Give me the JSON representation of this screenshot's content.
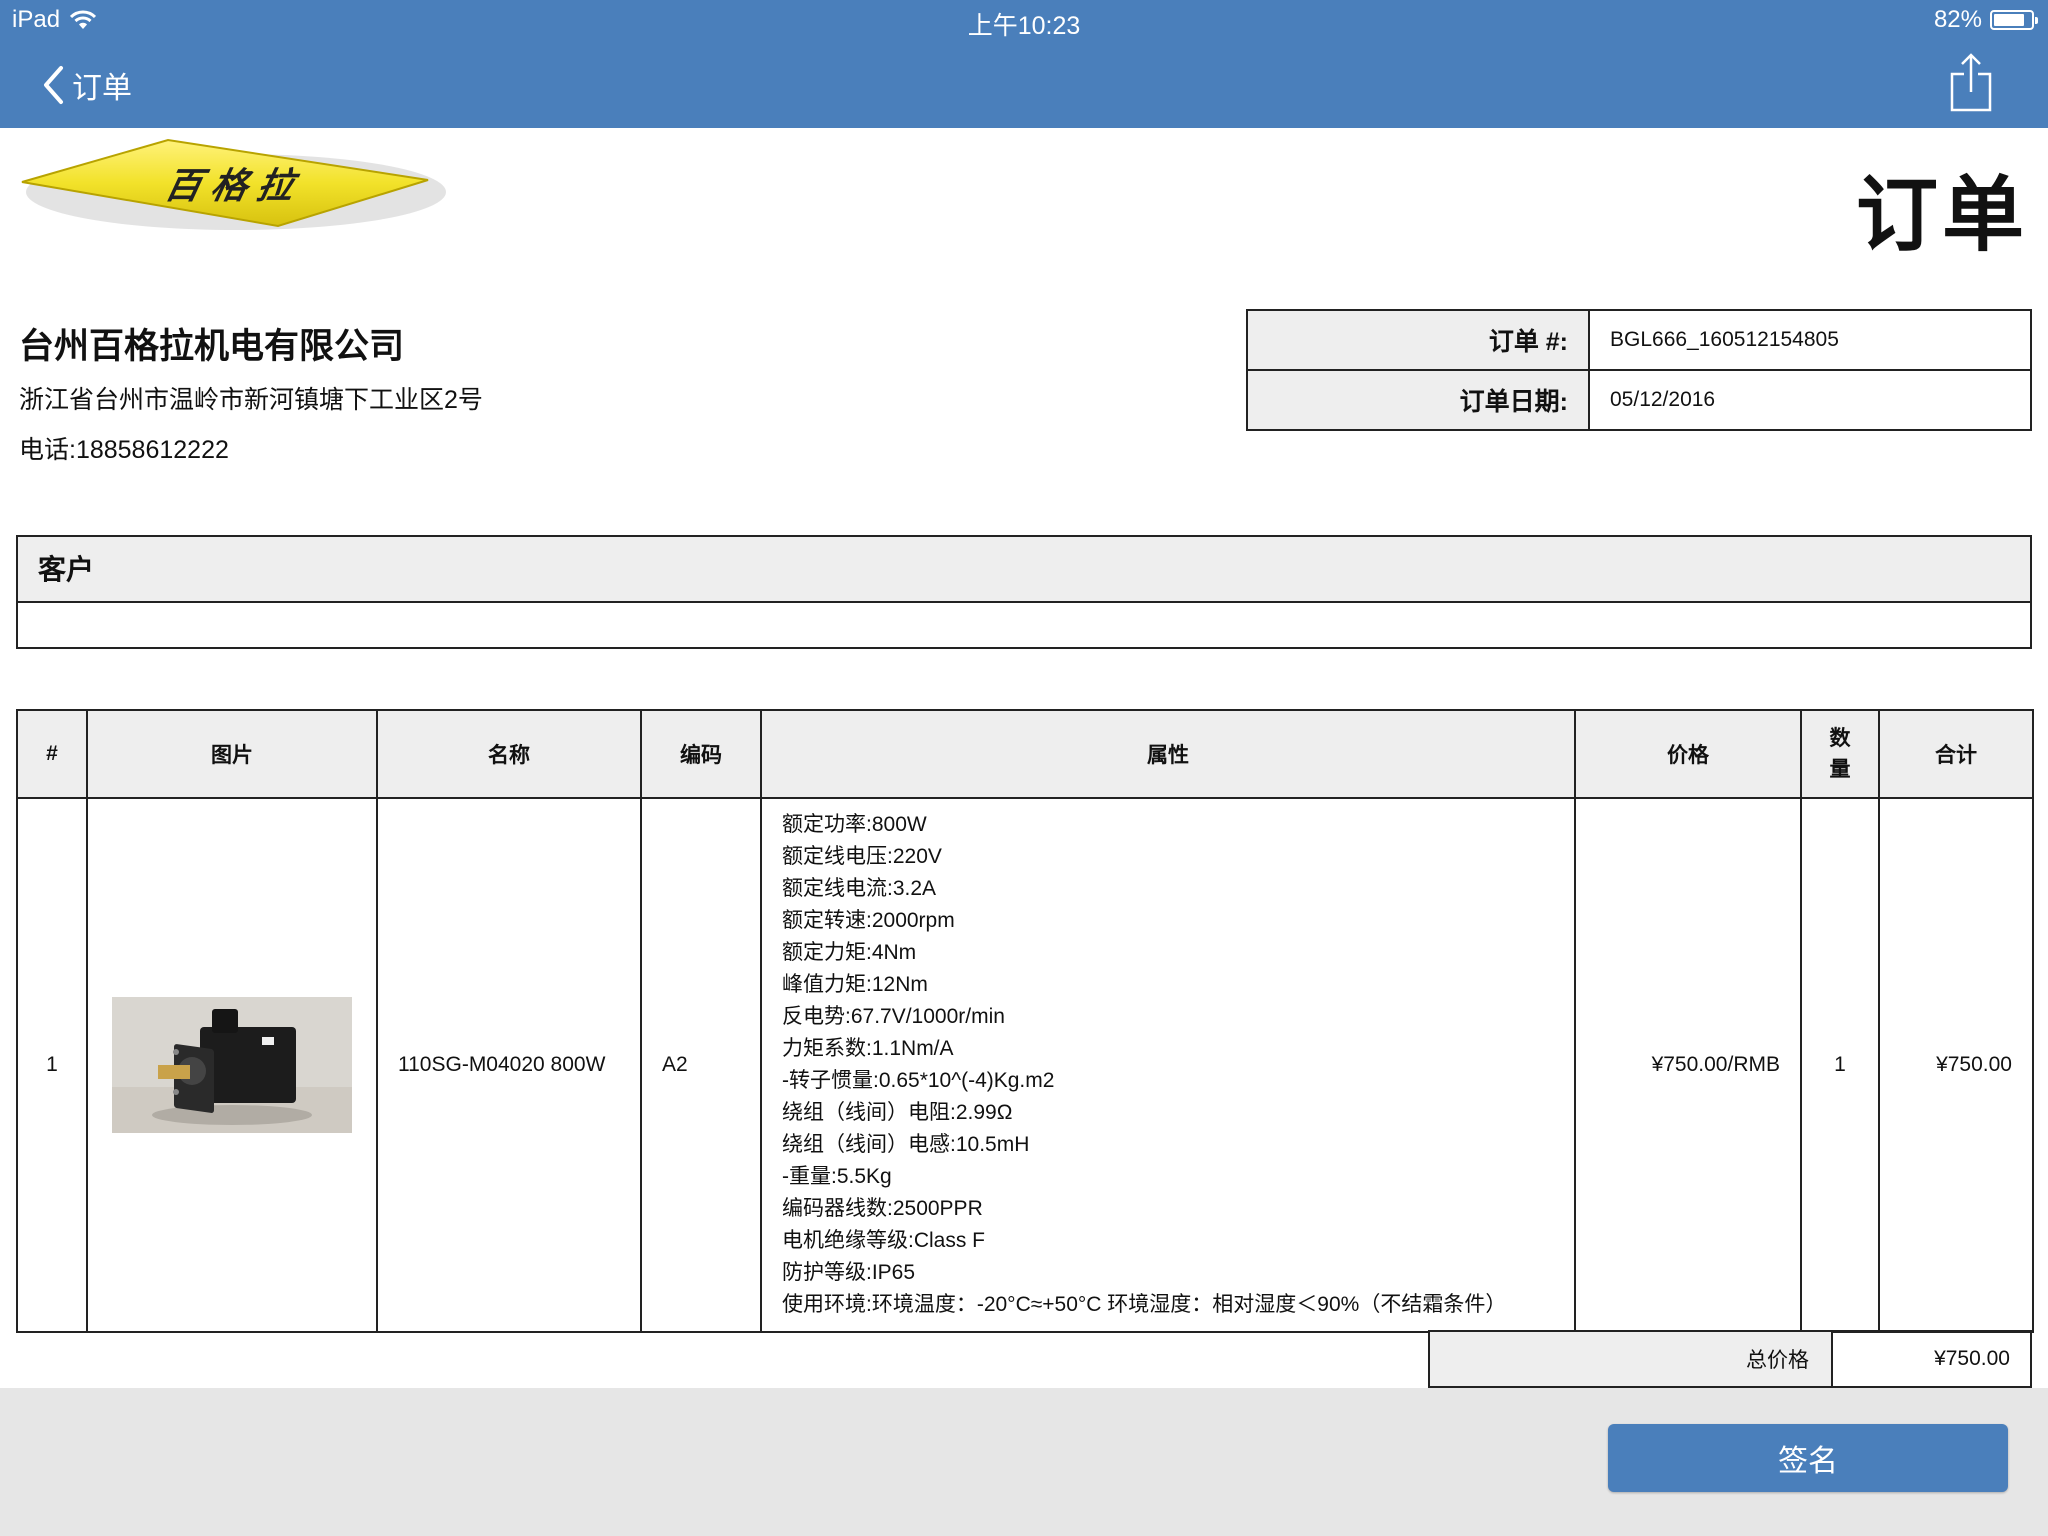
{
  "status_bar": {
    "device": "iPad",
    "time": "上午10:23",
    "battery": "82%",
    "battery_level": 0.82
  },
  "nav": {
    "back_label": "订单",
    "back_icon": "chevron-left-icon",
    "share_icon": "share-icon"
  },
  "document": {
    "logo_text": "百格拉",
    "title": "订单"
  },
  "company": {
    "name": "台州百格拉机电有限公司",
    "address": "浙江省台州市温岭市新河镇塘下工业区2号",
    "phone": "电话:18858612222"
  },
  "order_meta": {
    "number_label": "订单 #:",
    "number_value": "BGL666_160512154805",
    "date_label": "订单日期:",
    "date_value": "05/12/2016"
  },
  "customer": {
    "heading": "客户",
    "value": ""
  },
  "items_table": {
    "headers": {
      "num": "#",
      "image": "图片",
      "name": "名称",
      "code": "编码",
      "attributes": "属性",
      "price": "价格",
      "qty": "数量",
      "total": "合计"
    },
    "rows": [
      {
        "num": "1",
        "name": "110SG-M04020 800W",
        "code": "A2",
        "attributes": [
          "额定功率:800W",
          "额定线电压:220V",
          "额定线电流:3.2A",
          "额定转速:2000rpm",
          "额定力矩:4Nm",
          "峰值力矩:12Nm",
          "反电势:67.7V/1000r/min",
          "力矩系数:1.1Nm/A",
          "-转子惯量:0.65*10^(-4)Kg.m2",
          "绕组（线间）电阻:2.99Ω",
          "绕组（线间）电感:10.5mH",
          "-重量:5.5Kg",
          "编码器线数:2500PPR",
          "电机绝缘等级:Class F",
          "防护等级:IP65",
          "使用环境:环境温度：-20°C≈+50°C  环境湿度：相对湿度＜90%（不结霜条件）"
        ],
        "price": "¥750.00/RMB",
        "qty": "1",
        "total": "¥750.00"
      }
    ]
  },
  "summary": {
    "total_label": "总价格",
    "total_value": "¥750.00"
  },
  "actions": {
    "sign_label": "签名"
  },
  "colors": {
    "nav_bar": "#4a7fbb",
    "header_cell": "#eeeeee",
    "footer": "#e6e6e6",
    "logo_yellow": "#f2e22a"
  }
}
